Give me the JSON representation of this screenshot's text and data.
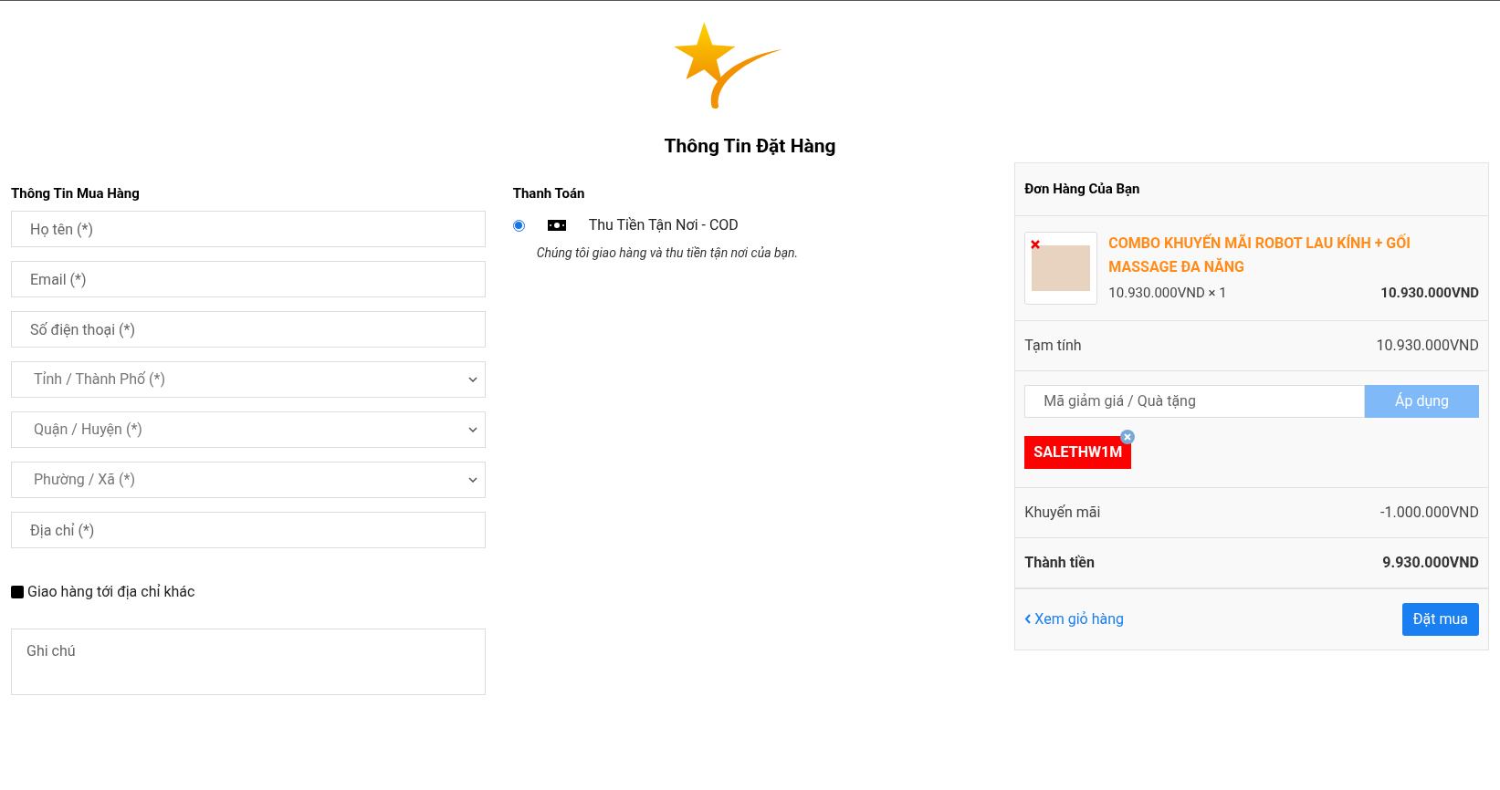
{
  "page_title": "Thông Tin Đặt Hàng",
  "buyer": {
    "heading": "Thông Tin Mua Hàng",
    "fields": [
      {
        "kind": "input",
        "placeholder": "Họ tên (*)"
      },
      {
        "kind": "input",
        "placeholder": "Email (*)"
      },
      {
        "kind": "input",
        "placeholder": "Số điện thoại (*)"
      },
      {
        "kind": "select",
        "placeholder": "Tỉnh / Thành Phố (*)"
      },
      {
        "kind": "select",
        "placeholder": "Quận / Huyện (*)"
      },
      {
        "kind": "select",
        "placeholder": "Phường / Xã (*)"
      },
      {
        "kind": "input",
        "placeholder": "Địa chỉ (*)"
      }
    ],
    "other_address": {
      "label": "Giao hàng tới địa chỉ khác",
      "checked": false
    },
    "note": {
      "placeholder": "Ghi chú"
    }
  },
  "payment": {
    "heading": "Thanh Toán",
    "methods": [
      {
        "label": "Thu Tiền Tận Nơi - COD",
        "selected": true,
        "description": "Chúng tôi giao hàng và thu tiền tận nơi của bạn."
      }
    ]
  },
  "order": {
    "heading": "Đơn Hàng Của Bạn",
    "items": [
      {
        "name": "COMBO KHUYẾN MÃI ROBOT LAU KÍNH + GỐI MASSAGE ĐA NĂNG",
        "unit": "10.930.000VND × 1",
        "total": "10.930.000VND"
      }
    ],
    "subtotal": {
      "label": "Tạm tính",
      "value": "10.930.000VND"
    },
    "coupon": {
      "placeholder": "Mã giảm giá / Quà tặng",
      "button": "Áp dụng",
      "applied": [
        "SALETHW1M"
      ]
    },
    "discount": {
      "label": "Khuyến mãi",
      "value": "-1.000.000VND"
    },
    "total": {
      "label": "Thành tiền",
      "value": "9.930.000VND"
    },
    "back_link": "Xem giỏ hàng",
    "submit": "Đặt mua"
  }
}
